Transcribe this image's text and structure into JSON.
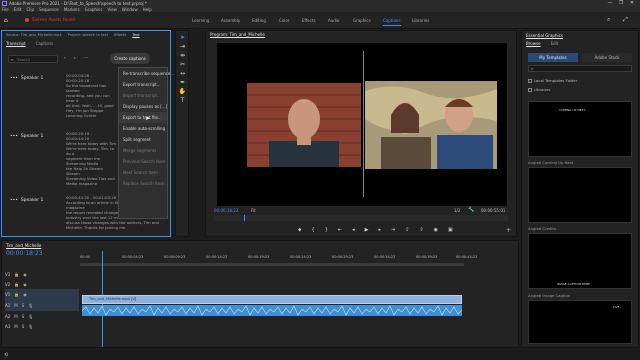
{
  "window": {
    "title": "Adobe Premiere Pro 2021 - D:\\Text_to_Speech\\speech to text.prproj *",
    "controls": [
      "—",
      "❐",
      "✕"
    ]
  },
  "menubar": {
    "items": [
      "File",
      "Edit",
      "Clip",
      "Sequence",
      "Markers",
      "Graphics",
      "View",
      "Window",
      "Help"
    ]
  },
  "workspaces": {
    "record_label": "Sixteen Assets Found",
    "tabs": [
      "Learning",
      "Assembly",
      "Editing",
      "Color",
      "Effects",
      "Audio",
      "Graphics",
      "Captions",
      "Libraries"
    ],
    "active": "Captions"
  },
  "text_panel": {
    "top_tabs": [
      "Source: Tim_and_Michelle.mp4",
      "Project: speech to text",
      "Effects",
      "Text"
    ],
    "tabs": [
      "Transcript",
      "Captions"
    ],
    "active_tab": "Transcript",
    "search_placeholder": "Search",
    "create_captions_label": "Create captions",
    "entries": [
      {
        "speaker": "Speaker 1",
        "timecode": "00:00:04:26 - 00:00:20:18",
        "lines": [
          "So the broadcast has started",
          "recording, and you can hear it",
          "all that. Yeah, ... Hi, good",
          "Hey, I'm Jan Steppe",
          "Learning Center"
        ]
      },
      {
        "speaker": "Speaker 1",
        "timecode": "00:00:20:19 - 00:00:44:20",
        "lines": [
          "We're here today with Tim",
          "We're here today, Tim, to do a",
          "segment from the Streaming Media",
          "the Help 3x Stream Stream",
          "Streaming Video Tips and",
          "Media magazine"
        ]
      },
      {
        "speaker": "Speaker 1",
        "timecode": "00:00:44:20 - 00:01:03:26",
        "lines": [
          "According to an article in Streaming Media magazine",
          "the report revealed changes to the streaming",
          "industry over the last 12 months. We're here to",
          "discuss those changes with the authors, Tim and",
          "Michelle. Thanks for joining me."
        ]
      }
    ],
    "context_menu": [
      {
        "label": "Re-transcribe sequence...",
        "disabled": false
      },
      {
        "label": "Export transcript...",
        "disabled": false
      },
      {
        "label": "Import transcript...",
        "disabled": true
      },
      {
        "label": "Display pauses as [...]",
        "disabled": false
      },
      {
        "label": "Export to text file...",
        "disabled": false,
        "hover": true
      },
      {
        "label": "Enable auto-scrolling",
        "disabled": false
      },
      {
        "label": "Split segment",
        "disabled": false
      },
      {
        "label": "Merge segments",
        "disabled": true
      },
      {
        "label": "Previous Search Item",
        "disabled": true
      },
      {
        "label": "Next Search Item",
        "disabled": true
      },
      {
        "label": "Replace Search Item",
        "disabled": true
      }
    ]
  },
  "program_monitor": {
    "title": "Program: Tim_and_Michelle",
    "timecode_left": "00:00:18:23",
    "fit": "Fit",
    "resolution": "1/2",
    "timecode_right": "00:00:55:01"
  },
  "timeline": {
    "tab": "Tim_and_Michelle",
    "timecode": "00:00:18:23",
    "ruler": [
      "00:00",
      "00:00:04:23",
      "00:00:09:23",
      "00:00:14:23",
      "00:00:19:23",
      "00:00:24:23",
      "00:00:29:23",
      "00:00:34:23",
      "00:00:39:23",
      "00:00:44:23"
    ],
    "tracks": [
      "V3",
      "V2",
      "V1",
      "A1",
      "A2",
      "A3"
    ],
    "clip_label": "Tim_and_Michelle.mp4 [V]"
  },
  "essential_graphics": {
    "title": "Essential Graphics",
    "tabs": [
      "Browse",
      "Edit"
    ],
    "location": "My Templates",
    "dropdown": "Adobe Stock",
    "filter_local": "Local Templates Folder",
    "filter_libraries": "Libraries",
    "templates": [
      {
        "label": "Angled Coming Up Next",
        "text": "COMING UP NEXT"
      },
      {
        "label": "Angled Credits",
        "text": ""
      },
      {
        "label": "Angled Image Caption",
        "text": "IMAGE CAPTION HERE"
      },
      {
        "label": "",
        "text": "LIVE"
      }
    ]
  },
  "colors": {
    "accent": "#3d8eff",
    "clip_video": "#8fb0d8",
    "clip_audio": "#3f8fd1",
    "record": "#e13b3b"
  }
}
